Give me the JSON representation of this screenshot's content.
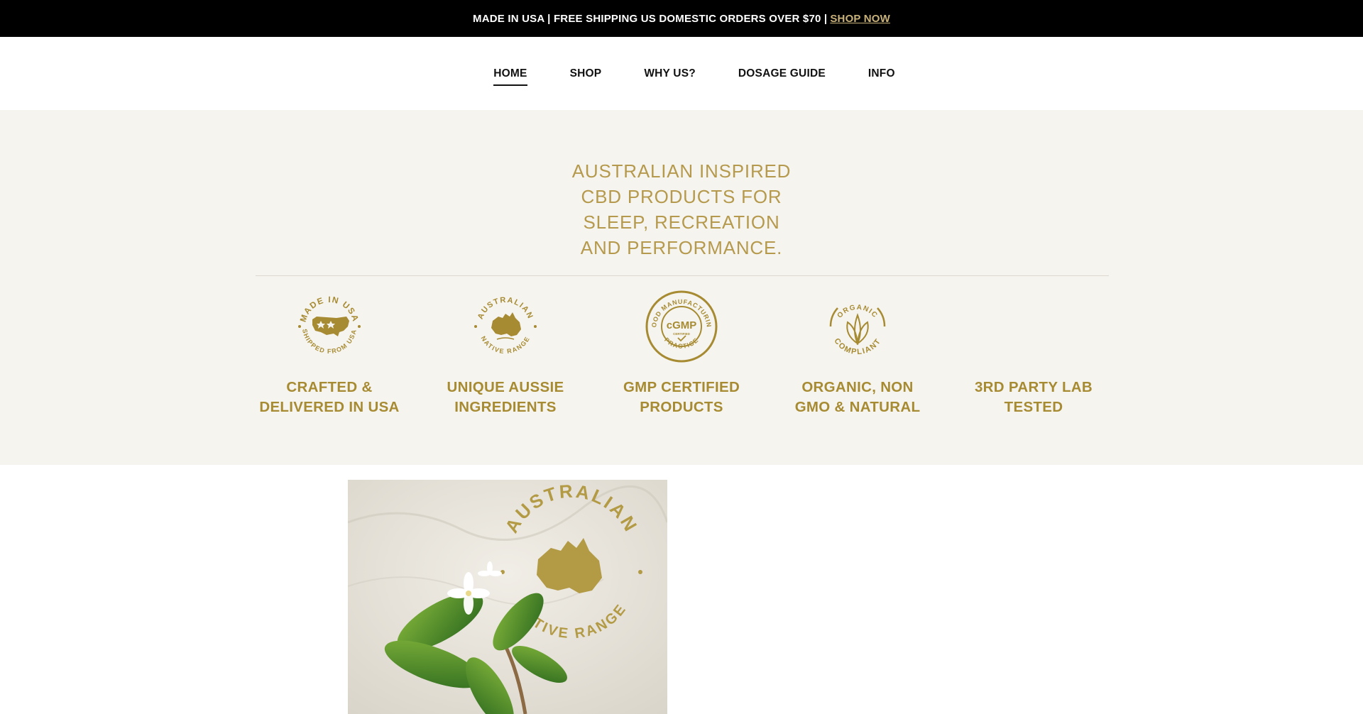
{
  "announcement": {
    "text": "MADE IN USA | FREE SHIPPING US DOMESTIC ORDERS OVER $70 |",
    "link": "SHOP NOW",
    "link_color": "#c9b27a"
  },
  "nav": {
    "items": [
      {
        "label": "HOME",
        "active": true
      },
      {
        "label": "SHOP"
      },
      {
        "label": "WHY US?"
      },
      {
        "label": "DOSAGE GUIDE"
      },
      {
        "label": "INFO"
      }
    ]
  },
  "hero": {
    "tagline_lines": [
      "AUSTRALIAN INSPIRED",
      "CBD PRODUCTS FOR",
      "SLEEP, RECREATION",
      "AND PERFORMANCE."
    ],
    "accent_color": "#b59a4d",
    "background_color": "#f6f4ef"
  },
  "features": [
    {
      "badge_icon": "made-in-usa-badge-icon",
      "badge_text": [
        "MADE IN USA",
        "SHIPPED FROM USA"
      ],
      "label_lines": [
        "CRAFTED &",
        "DELIVERED IN USA"
      ]
    },
    {
      "badge_icon": "australian-native-range-badge-icon",
      "badge_text": [
        "AUSTRALIAN",
        "NATIVE RANGE"
      ],
      "label_lines": [
        "UNIQUE AUSSIE",
        "INGREDIENTS"
      ]
    },
    {
      "badge_icon": "cgmp-badge-icon",
      "badge_text": [
        "GOOD MANUFACTURING",
        "PRACTICE",
        "cGMP",
        "CERTIFIED"
      ],
      "label_lines": [
        "GMP CERTIFIED",
        "PRODUCTS"
      ]
    },
    {
      "badge_icon": "organic-compliant-badge-icon",
      "badge_text": [
        "ORGANIC",
        "COMPLIANT"
      ],
      "label_lines": [
        "ORGANIC, NON",
        "GMO & NATURAL"
      ]
    },
    {
      "badge_icon": "",
      "badge_text": [],
      "label_lines": [
        "3RD PARTY LAB",
        "TESTED"
      ]
    }
  ],
  "product_image": {
    "badge_text": [
      "AUSTRALIAN",
      "NATIVE RANGE"
    ]
  }
}
